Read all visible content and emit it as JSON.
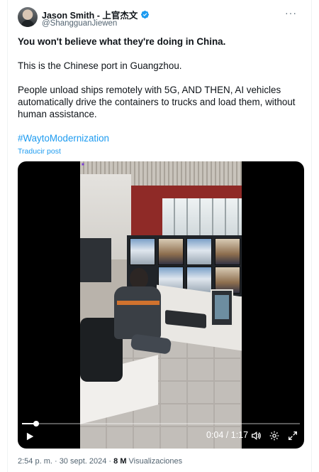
{
  "author": {
    "name": "Jason Smith - 上官杰文",
    "handle": "@ShangguanJiewen"
  },
  "menu_label": "···",
  "tweet": {
    "headline": "You won't believe what they're doing in China.",
    "para1": "This is the Chinese port in Guangzhou.",
    "para2": "People unload ships remotely with 5G, AND THEN, AI vehicles automatically drive the containers to trucks and load them, without human assistance.",
    "hashtag": "#WaytoModernization",
    "translate": "Traducir post"
  },
  "video": {
    "time": "0:04 / 1:17",
    "progress": 0.05
  },
  "meta": {
    "timestamp": "2:54 p. m. · 30 sept. 2024 · ",
    "views_count": "8 M",
    "views_label": " Visualizaciones"
  },
  "icons": [
    "verified-badge-icon",
    "more-icon",
    "play-icon",
    "volume-icon",
    "settings-gear-icon",
    "fullscreen-icon"
  ],
  "colors": {
    "accent": "#1d9bf0",
    "text": "#0f1419",
    "secondary": "#536471"
  }
}
